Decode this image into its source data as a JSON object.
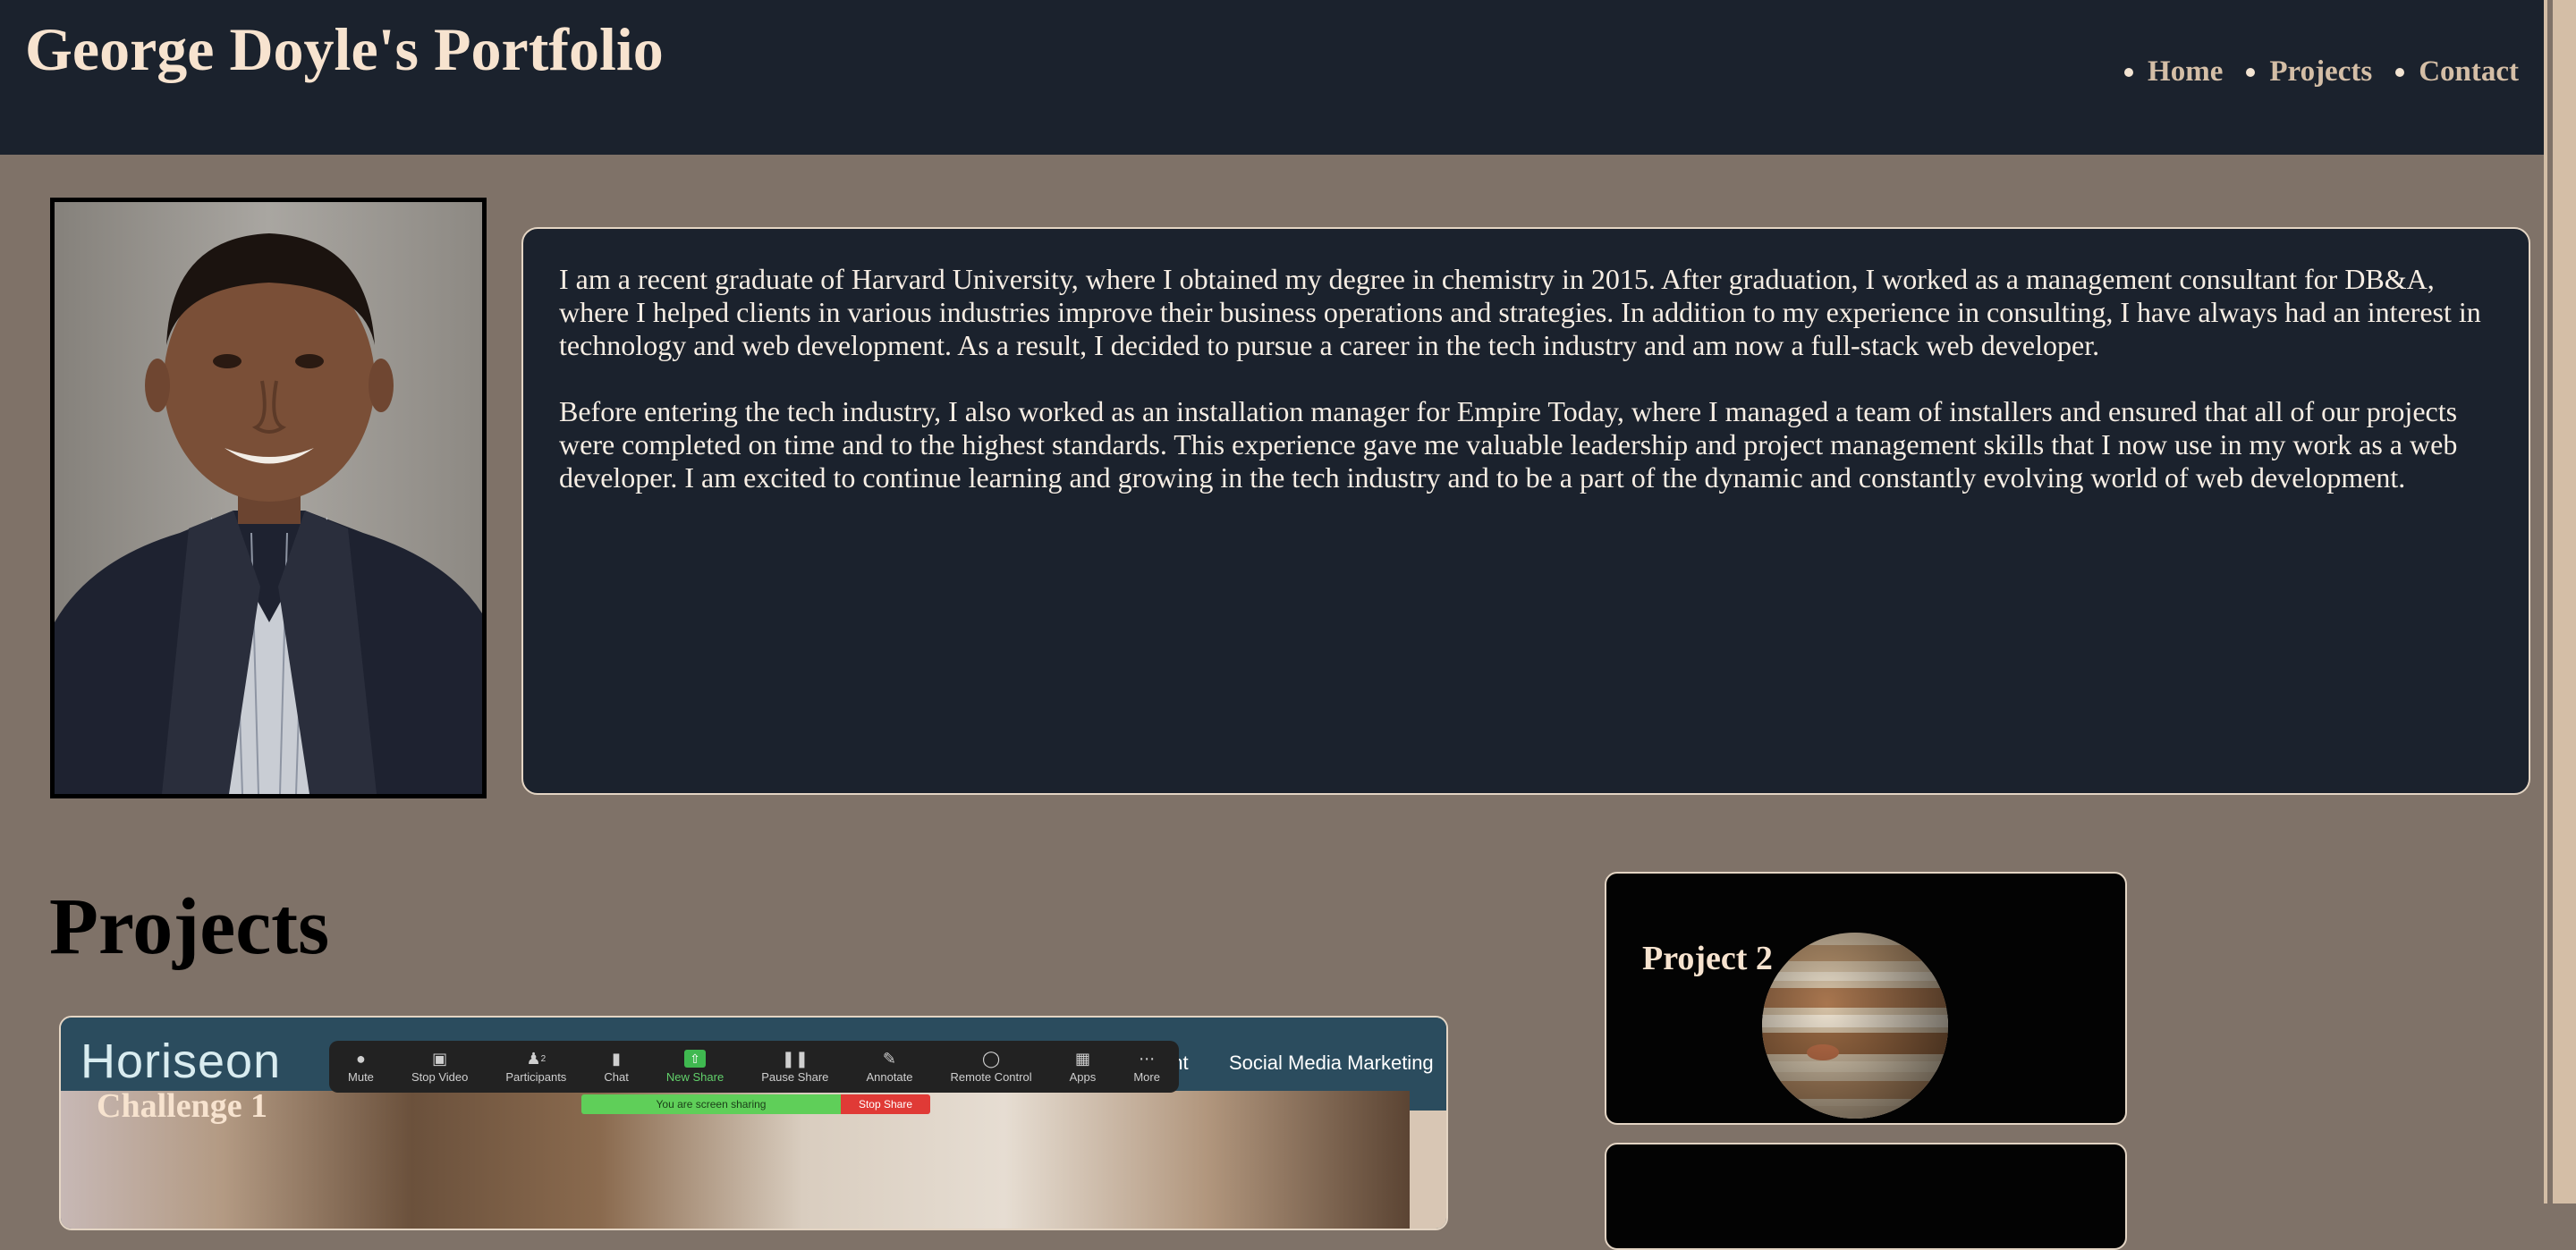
{
  "header": {
    "title": "George Doyle's Portfolio",
    "nav": [
      {
        "label": "Home"
      },
      {
        "label": "Projects"
      },
      {
        "label": "Contact"
      }
    ]
  },
  "about": {
    "paragraphs": [
      "I am a recent graduate of Harvard University, where I obtained my degree in chemistry in 2015. After graduation, I worked as a management consultant for DB&A, where I helped clients in various industries improve their business operations and strategies. In addition to my experience in consulting, I have always had an interest in technology and web development. As a result, I decided to pursue a career in the tech industry and am now a full-stack web developer.",
      "Before entering the tech industry, I also worked as an installation manager for Empire Today, where I managed a team of installers and ensured that all of our projects were completed on time and to the highest standards. This experience gave me valuable leadership and project management skills that I now use in my work as a web developer. I am excited to continue learning and growing in the tech industry and to be a part of the dynamic and constantly evolving world of web development."
    ]
  },
  "projects": {
    "heading": "Projects",
    "cards": [
      {
        "label": "Challenge 1",
        "screenshot": {
          "logo": "Horiseon",
          "nav_partial": "ent",
          "nav_item": "Social Media Marketing",
          "zoom_toolbar": [
            {
              "label": "Mute",
              "icon": "microphone-icon"
            },
            {
              "label": "Stop Video",
              "icon": "video-camera-icon"
            },
            {
              "label": "Participants",
              "icon": "participants-icon",
              "count": "2"
            },
            {
              "label": "Chat",
              "icon": "chat-icon"
            },
            {
              "label": "New Share",
              "icon": "share-up-arrow-icon"
            },
            {
              "label": "Pause Share",
              "icon": "pause-icon"
            },
            {
              "label": "Annotate",
              "icon": "pencil-icon"
            },
            {
              "label": "Remote Control",
              "icon": "mouse-icon"
            },
            {
              "label": "Apps",
              "icon": "apps-icon"
            },
            {
              "label": "More",
              "icon": "more-dots-icon"
            }
          ],
          "share_status": "You are screen sharing",
          "stop_share": "Stop Share"
        }
      },
      {
        "label": "Project 2"
      },
      {
        "label": ""
      }
    ]
  },
  "colors": {
    "page_background": "#7f7268",
    "header_background": "#1b222d",
    "title_color": "#f7e3cf",
    "nav_color": "#d4bea6",
    "about_background": "#1b222d",
    "about_text": "#f7eee4",
    "card_border": "#e4d5c4"
  }
}
